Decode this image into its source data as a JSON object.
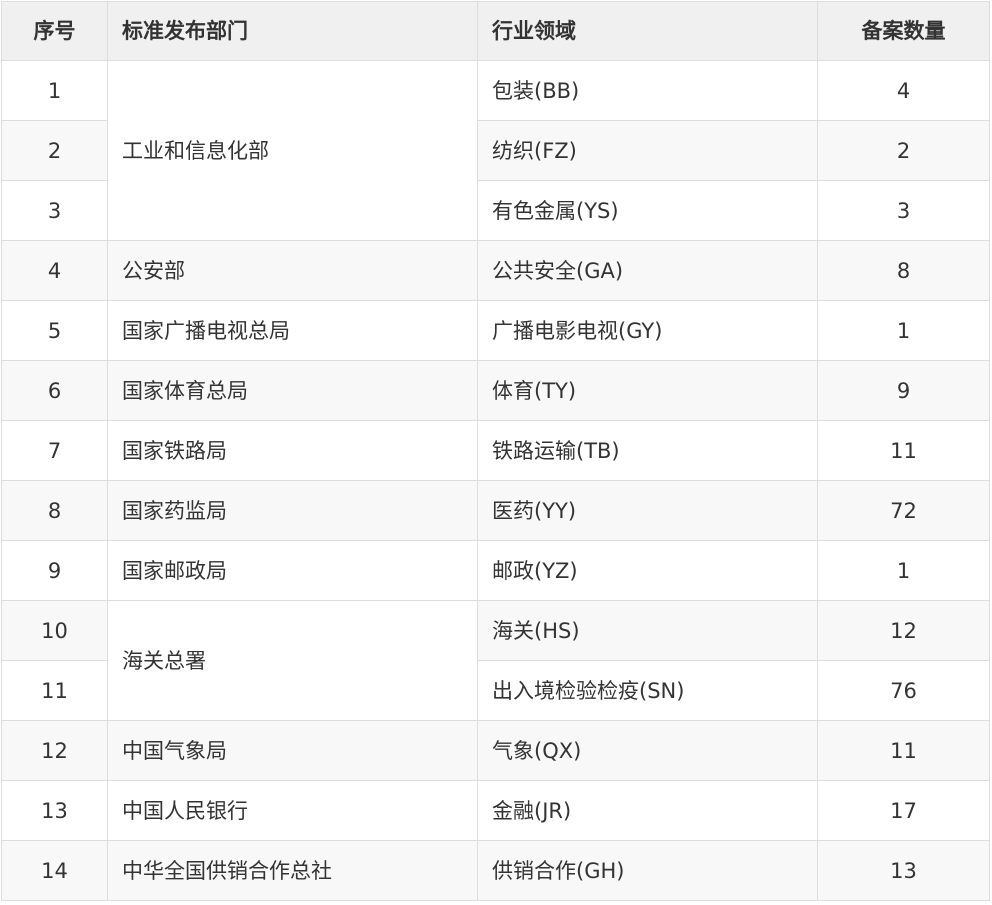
{
  "table": {
    "headers": {
      "no": "序号",
      "dept": "标准发布部门",
      "field": "行业领域",
      "count": "备案数量"
    },
    "rows": [
      {
        "no": "1",
        "dept": "工业和信息化部",
        "field": "包装(BB)",
        "count": "4"
      },
      {
        "no": "2",
        "dept": "",
        "field": "纺织(FZ)",
        "count": "2"
      },
      {
        "no": "3",
        "dept": "",
        "field": "有色金属(YS)",
        "count": "3"
      },
      {
        "no": "4",
        "dept": "公安部",
        "field": "公共安全(GA)",
        "count": "8"
      },
      {
        "no": "5",
        "dept": "国家广播电视总局",
        "field": "广播电影电视(GY)",
        "count": "1"
      },
      {
        "no": "6",
        "dept": "国家体育总局",
        "field": "体育(TY)",
        "count": "9"
      },
      {
        "no": "7",
        "dept": "国家铁路局",
        "field": "铁路运输(TB)",
        "count": "11"
      },
      {
        "no": "8",
        "dept": "国家药监局",
        "field": "医药(YY)",
        "count": "72"
      },
      {
        "no": "9",
        "dept": "国家邮政局",
        "field": "邮政(YZ)",
        "count": "1"
      },
      {
        "no": "10",
        "dept": "海关总署",
        "field": "海关(HS)",
        "count": "12"
      },
      {
        "no": "11",
        "dept": "",
        "field": "出入境检验检疫(SN)",
        "count": "76"
      },
      {
        "no": "12",
        "dept": "中国气象局",
        "field": "气象(QX)",
        "count": "11"
      },
      {
        "no": "13",
        "dept": "中国人民银行",
        "field": "金融(JR)",
        "count": "17"
      },
      {
        "no": "14",
        "dept": "中华全国供销合作总社",
        "field": "供销合作(GH)",
        "count": "13"
      }
    ]
  },
  "colors": {
    "header_bg": "#f0f0f0",
    "stripe_bg": "#f8f8f8",
    "border": "#dddddd",
    "text": "#333333"
  }
}
